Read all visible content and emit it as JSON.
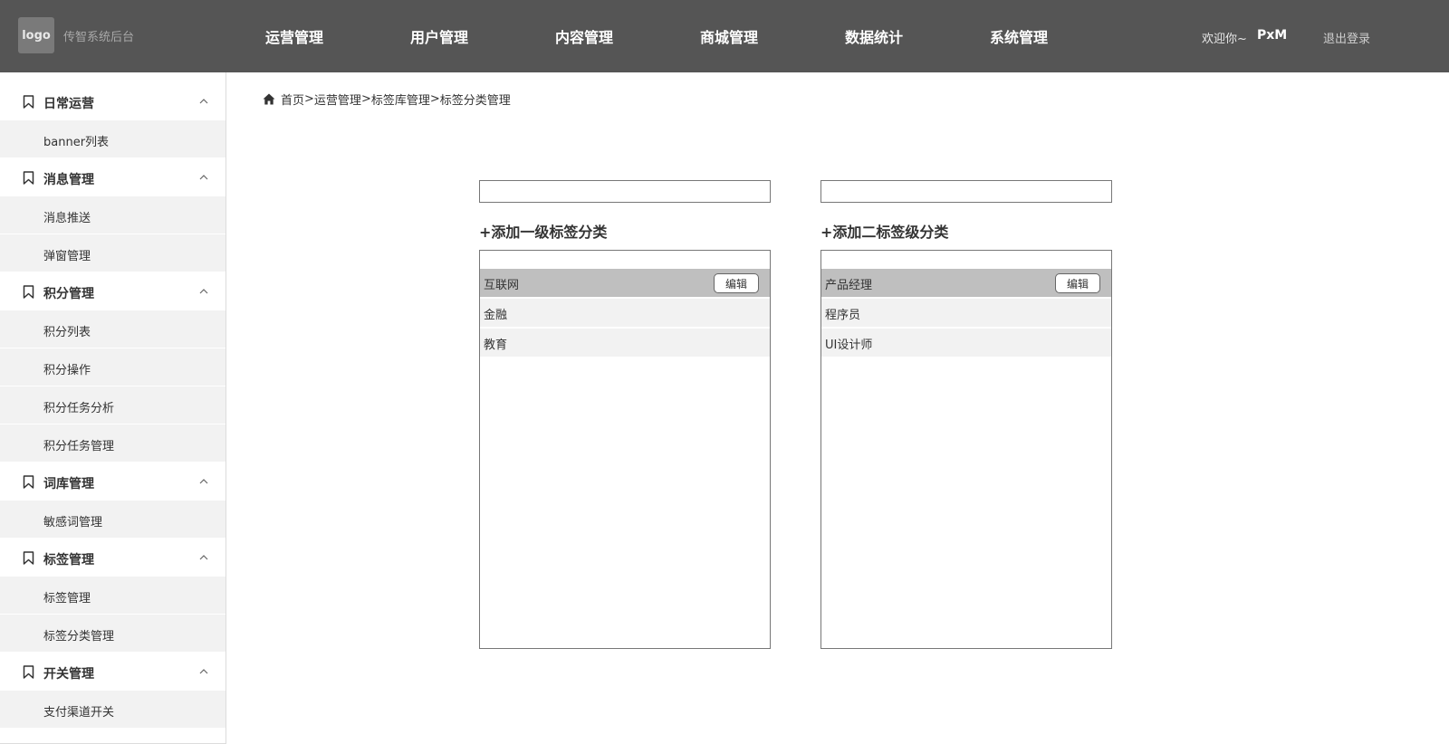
{
  "header": {
    "logo_text": "logo",
    "system_name": "传智系统后台",
    "nav": [
      "运营管理",
      "用户管理",
      "内容管理",
      "商城管理",
      "数据统计",
      "系统管理"
    ],
    "welcome": "欢迎你~",
    "username": "PxM",
    "logout": "退出登录"
  },
  "sidebar": {
    "groups": [
      {
        "label": "日常运营",
        "items": [
          "banner列表"
        ]
      },
      {
        "label": "消息管理",
        "items": [
          "消息推送",
          "弹窗管理"
        ]
      },
      {
        "label": "积分管理",
        "items": [
          "积分列表",
          "积分操作",
          "积分任务分析",
          "积分任务管理"
        ]
      },
      {
        "label": "词库管理",
        "items": [
          "敏感词管理"
        ]
      },
      {
        "label": "标签管理",
        "items": [
          "标签管理",
          "标签分类管理"
        ]
      },
      {
        "label": "开关管理",
        "items": [
          "支付渠道开关"
        ]
      }
    ]
  },
  "breadcrumb": {
    "home": "首页",
    "sep": ">",
    "path": [
      "运营管理",
      "标签库管理",
      "标签分类管理"
    ]
  },
  "left_panel": {
    "search_value": "",
    "add_label": "+添加一级标签分类",
    "rows": [
      "互联网",
      "金融",
      "教育"
    ],
    "edit_label": "编辑"
  },
  "right_panel": {
    "search_value": "",
    "add_label": "+添加二标签级分类",
    "rows": [
      "产品经理",
      "程序员",
      "UI设计师"
    ],
    "edit_label": "编辑"
  },
  "colors": {
    "header_bg": "#555555",
    "selected_row": "#bfbfbf",
    "row_bg": "#f2f2f2"
  }
}
